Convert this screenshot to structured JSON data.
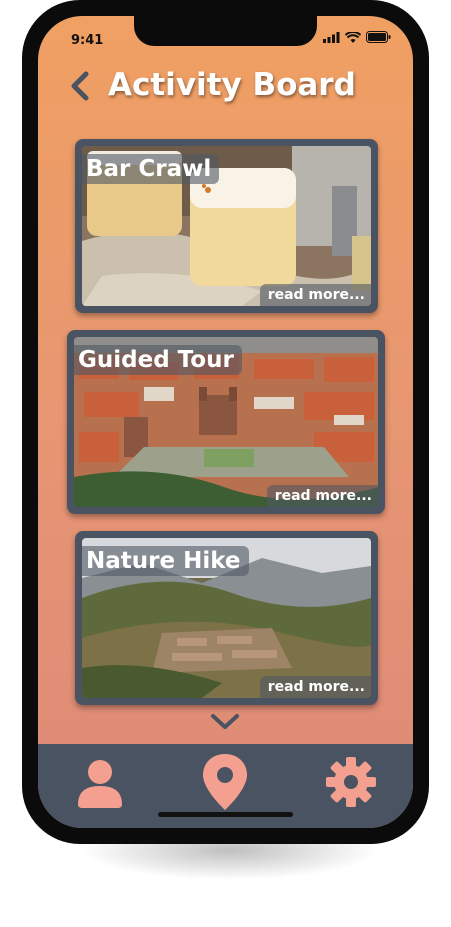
{
  "status": {
    "time": "9:41"
  },
  "header": {
    "title": "Activity Board"
  },
  "activities": [
    {
      "title": "Bar Crawl",
      "link": "read more..."
    },
    {
      "title": "Guided Tour",
      "link": "read more..."
    },
    {
      "title": "Nature Hike",
      "link": "read more..."
    }
  ],
  "tabs": [
    {
      "icon": "user-icon"
    },
    {
      "icon": "location-pin-icon"
    },
    {
      "icon": "gear-icon"
    }
  ],
  "colors": {
    "accent": "#f4a090",
    "dark": "#4a5361",
    "gradient_top": "#f0a062",
    "gradient_bottom": "#dd8a78"
  }
}
